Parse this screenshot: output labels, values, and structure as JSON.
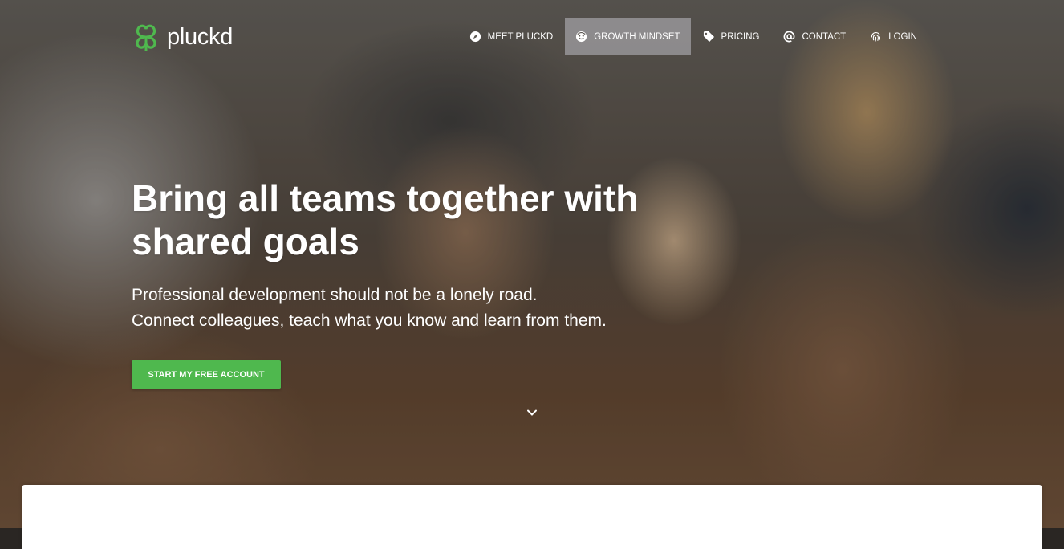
{
  "brand": {
    "name": "pluckd",
    "accent": "#4fb84e"
  },
  "nav": {
    "items": [
      {
        "label": "MEET PLUCKD",
        "icon": "compass-icon"
      },
      {
        "label": "GROWTH MINDSET",
        "icon": "smiley-icon",
        "active": true
      },
      {
        "label": "PRICING",
        "icon": "tag-icon"
      },
      {
        "label": "CONTACT",
        "icon": "at-icon"
      },
      {
        "label": "LOGIN",
        "icon": "fingerprint-icon"
      }
    ]
  },
  "hero": {
    "headline": "Bring all teams together with shared goals",
    "subline1": "Professional development should not be a lonely road.",
    "subline2": "Connect colleagues, teach what you know and learn from them.",
    "cta_label": "START MY FREE ACCOUNT",
    "scroll_icon": "chevron-down-icon"
  }
}
